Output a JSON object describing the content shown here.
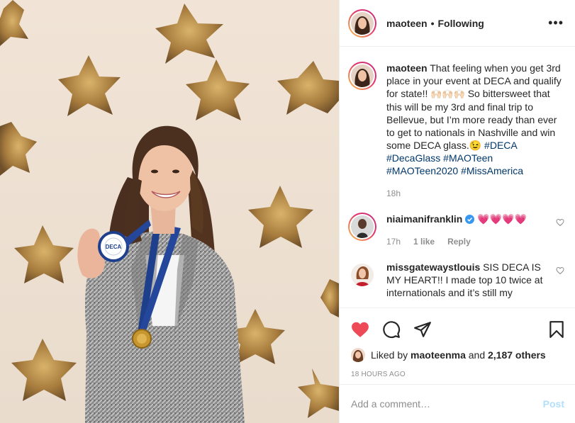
{
  "header": {
    "username": "maoteen",
    "dot": "•",
    "follow_label": "Following",
    "more_label": "•••"
  },
  "caption": {
    "username": "maoteen",
    "text_1": "That feeling when you get 3rd place in your event at DECA and qualify for state!!",
    "emoji_hands": "🙌🏻🙌🏻🙌🏻",
    "text_2": "So bittersweet that this will be my 3rd and final trip to Bellevue, but I’m more ready than ever to get to nationals in Nashville and win some DECA glass.",
    "emoji_wink": "😉",
    "hashtags": [
      "#DECA",
      "#DecaGlass",
      "#MAOTeen",
      "#MAOTeen2020",
      "#MissAmerica"
    ],
    "time": "18h"
  },
  "comments": [
    {
      "username": "niaimanifranklin",
      "text": "💗💗💗💗",
      "time": "17h",
      "likes": "1 like",
      "reply_label": "Reply"
    },
    {
      "username": "missgatewaystlouis",
      "text": "SIS DECA IS MY HEART!! I made top 10 twice at internationals and it’s still my"
    }
  ],
  "likes": {
    "prefix": "Liked by",
    "user": "maoteenma",
    "and": "and",
    "count": "2,187 others"
  },
  "timestamp": "18 HOURS AGO",
  "add_comment": {
    "placeholder": "Add a comment…",
    "post_label": "Post"
  },
  "photo": {
    "medal_text": "DECA"
  },
  "colors": {
    "heart_red": "#ed4956",
    "link_blue": "#00376b",
    "post_disabled": "#b2dffc",
    "verified_blue": "#3897f0"
  }
}
